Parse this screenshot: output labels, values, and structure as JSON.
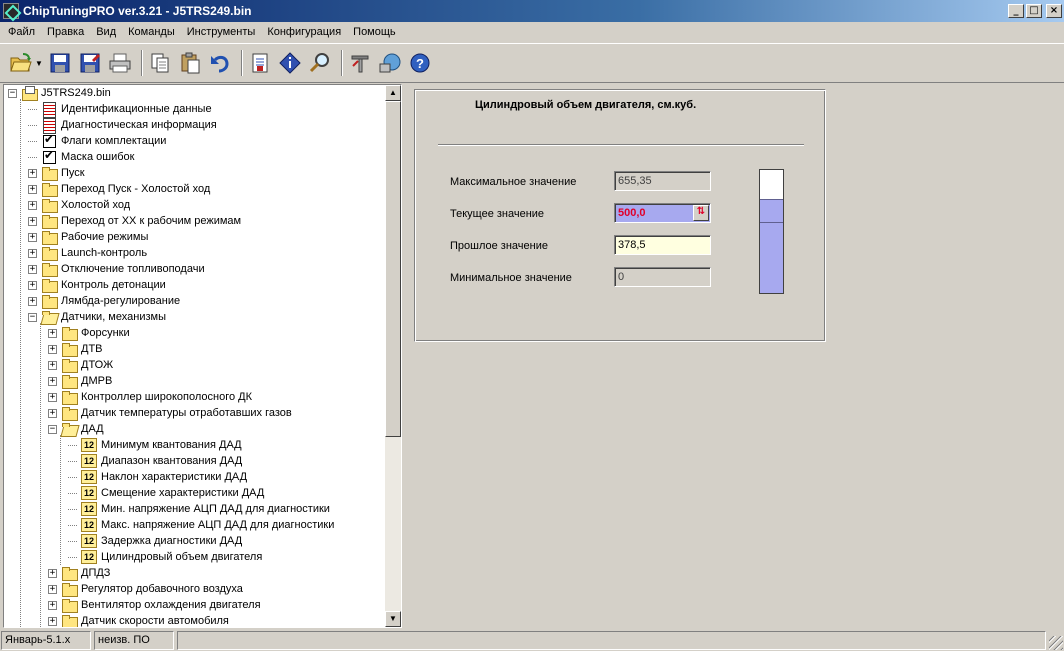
{
  "window": {
    "title": "ChipTuningPRO ver.3.21 - J5TRS249.bin",
    "controls": {
      "minimize": "_",
      "maximize": "□",
      "close": "×"
    }
  },
  "menu": [
    "Файл",
    "Правка",
    "Вид",
    "Команды",
    "Инструменты",
    "Конфигурация",
    "Помощь"
  ],
  "toolbar": {
    "buttons": [
      "open-icon",
      "save-icon",
      "save-as-icon",
      "print-icon",
      "copy-icon",
      "paste-icon",
      "undo-icon",
      "document-icon",
      "info-icon",
      "search-icon",
      "tools-icon",
      "connect-icon",
      "help-icon"
    ]
  },
  "tree": {
    "root": "J5TRS249.bin",
    "items": [
      {
        "label": "Идентификационные данные",
        "icon": "doc"
      },
      {
        "label": "Диагностическая информация",
        "icon": "doc"
      },
      {
        "label": "Флаги комплектации",
        "icon": "check"
      },
      {
        "label": "Маска ошибок",
        "icon": "check"
      },
      {
        "label": "Пуск",
        "icon": "folder"
      },
      {
        "label": "Переход Пуск - Холостой ход",
        "icon": "folder"
      },
      {
        "label": "Холостой ход",
        "icon": "folder"
      },
      {
        "label": "Переход от ХХ к рабочим режимам",
        "icon": "folder"
      },
      {
        "label": "Рабочие режимы",
        "icon": "folder"
      },
      {
        "label": "Launch-контроль",
        "icon": "folder"
      },
      {
        "label": "Отключение топливоподачи",
        "icon": "folder"
      },
      {
        "label": "Контроль детонации",
        "icon": "folder"
      },
      {
        "label": "Лямбда-регулирование",
        "icon": "folder"
      },
      {
        "label": "Датчики, механизмы",
        "icon": "openfolder"
      }
    ],
    "sensors": [
      {
        "label": "Форсунки"
      },
      {
        "label": "ДТВ"
      },
      {
        "label": "ДТОЖ"
      },
      {
        "label": "ДМРВ"
      },
      {
        "label": "Контроллер широкополосного ДК"
      },
      {
        "label": "Датчик температуры отработавших газов"
      },
      {
        "label": "ДАД"
      }
    ],
    "dad_items": [
      "Минимум квантования ДАД",
      "Диапазон квантования ДАД",
      "Наклон характеристики ДАД",
      "Смещение характеристики ДАД",
      "Мин. напряжение АЦП ДАД для диагностики",
      "Макс. напряжение АЦП ДАД для диагностики",
      "Задержка диагностики ДАД",
      "Цилиндровый объем двигателя"
    ],
    "num_icon_text": "12",
    "after": [
      "ДПДЗ",
      "Регулятор добавочного воздуха",
      "Вентилятор охлаждения двигателя",
      "Датчик скорости автомобиля"
    ]
  },
  "param": {
    "title": "Цилиндровый объем двигателя, см.куб.",
    "max_label": "Максимальное значение",
    "max_value": "655,35",
    "current_label": "Текущее значение",
    "current_value": "500,0",
    "prev_label": "Прошлое значение",
    "prev_value": "378,5",
    "min_label": "Минимальное значение",
    "min_value": "0",
    "gauge_fraction": 0.763,
    "gauge_prev_fraction": 0.578
  },
  "status": [
    "Январь-5.1.x",
    "неизв. ПО"
  ],
  "colors": {
    "current_bg": "#a7a9ef",
    "current_text": "#e0002a",
    "prev_bg": "#ffffe0"
  }
}
